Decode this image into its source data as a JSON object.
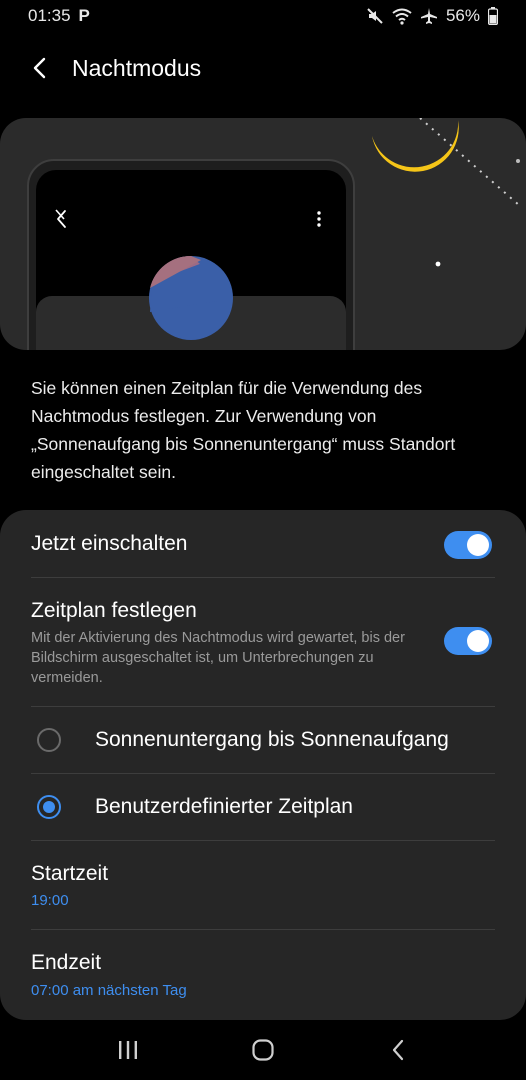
{
  "status": {
    "time": "01:35",
    "parking_icon": "P",
    "battery": "56%"
  },
  "header": {
    "title": "Nachtmodus",
    "back_icon": "chevron-left-icon"
  },
  "description": "Sie können einen Zeitplan für die Verwendung des Nachtmodus festlegen. Zur Verwendung von „Sonnenaufgang bis Sonnenuntergang“ muss Standort eingeschaltet sein.",
  "settings": {
    "turn_on_now": {
      "label": "Jetzt einschalten",
      "enabled": true
    },
    "schedule": {
      "label": "Zeitplan festlegen",
      "subtitle": "Mit der Aktivierung des Nachtmodus wird gewartet, bis der Bildschirm ausgeschaltet ist, um Unterbrechungen zu vermeiden.",
      "enabled": true
    },
    "options": [
      {
        "label": "Sonnenuntergang bis Sonnenaufgang",
        "selected": false
      },
      {
        "label": "Benutzerdefinierter Zeitplan",
        "selected": true
      }
    ],
    "start": {
      "label": "Startzeit",
      "value": "19:00"
    },
    "end": {
      "label": "Endzeit",
      "value": "07:00 am nächsten Tag"
    }
  },
  "colors": {
    "accent": "#3e8ef0",
    "card": "#262626",
    "moon": "#f5c518"
  }
}
